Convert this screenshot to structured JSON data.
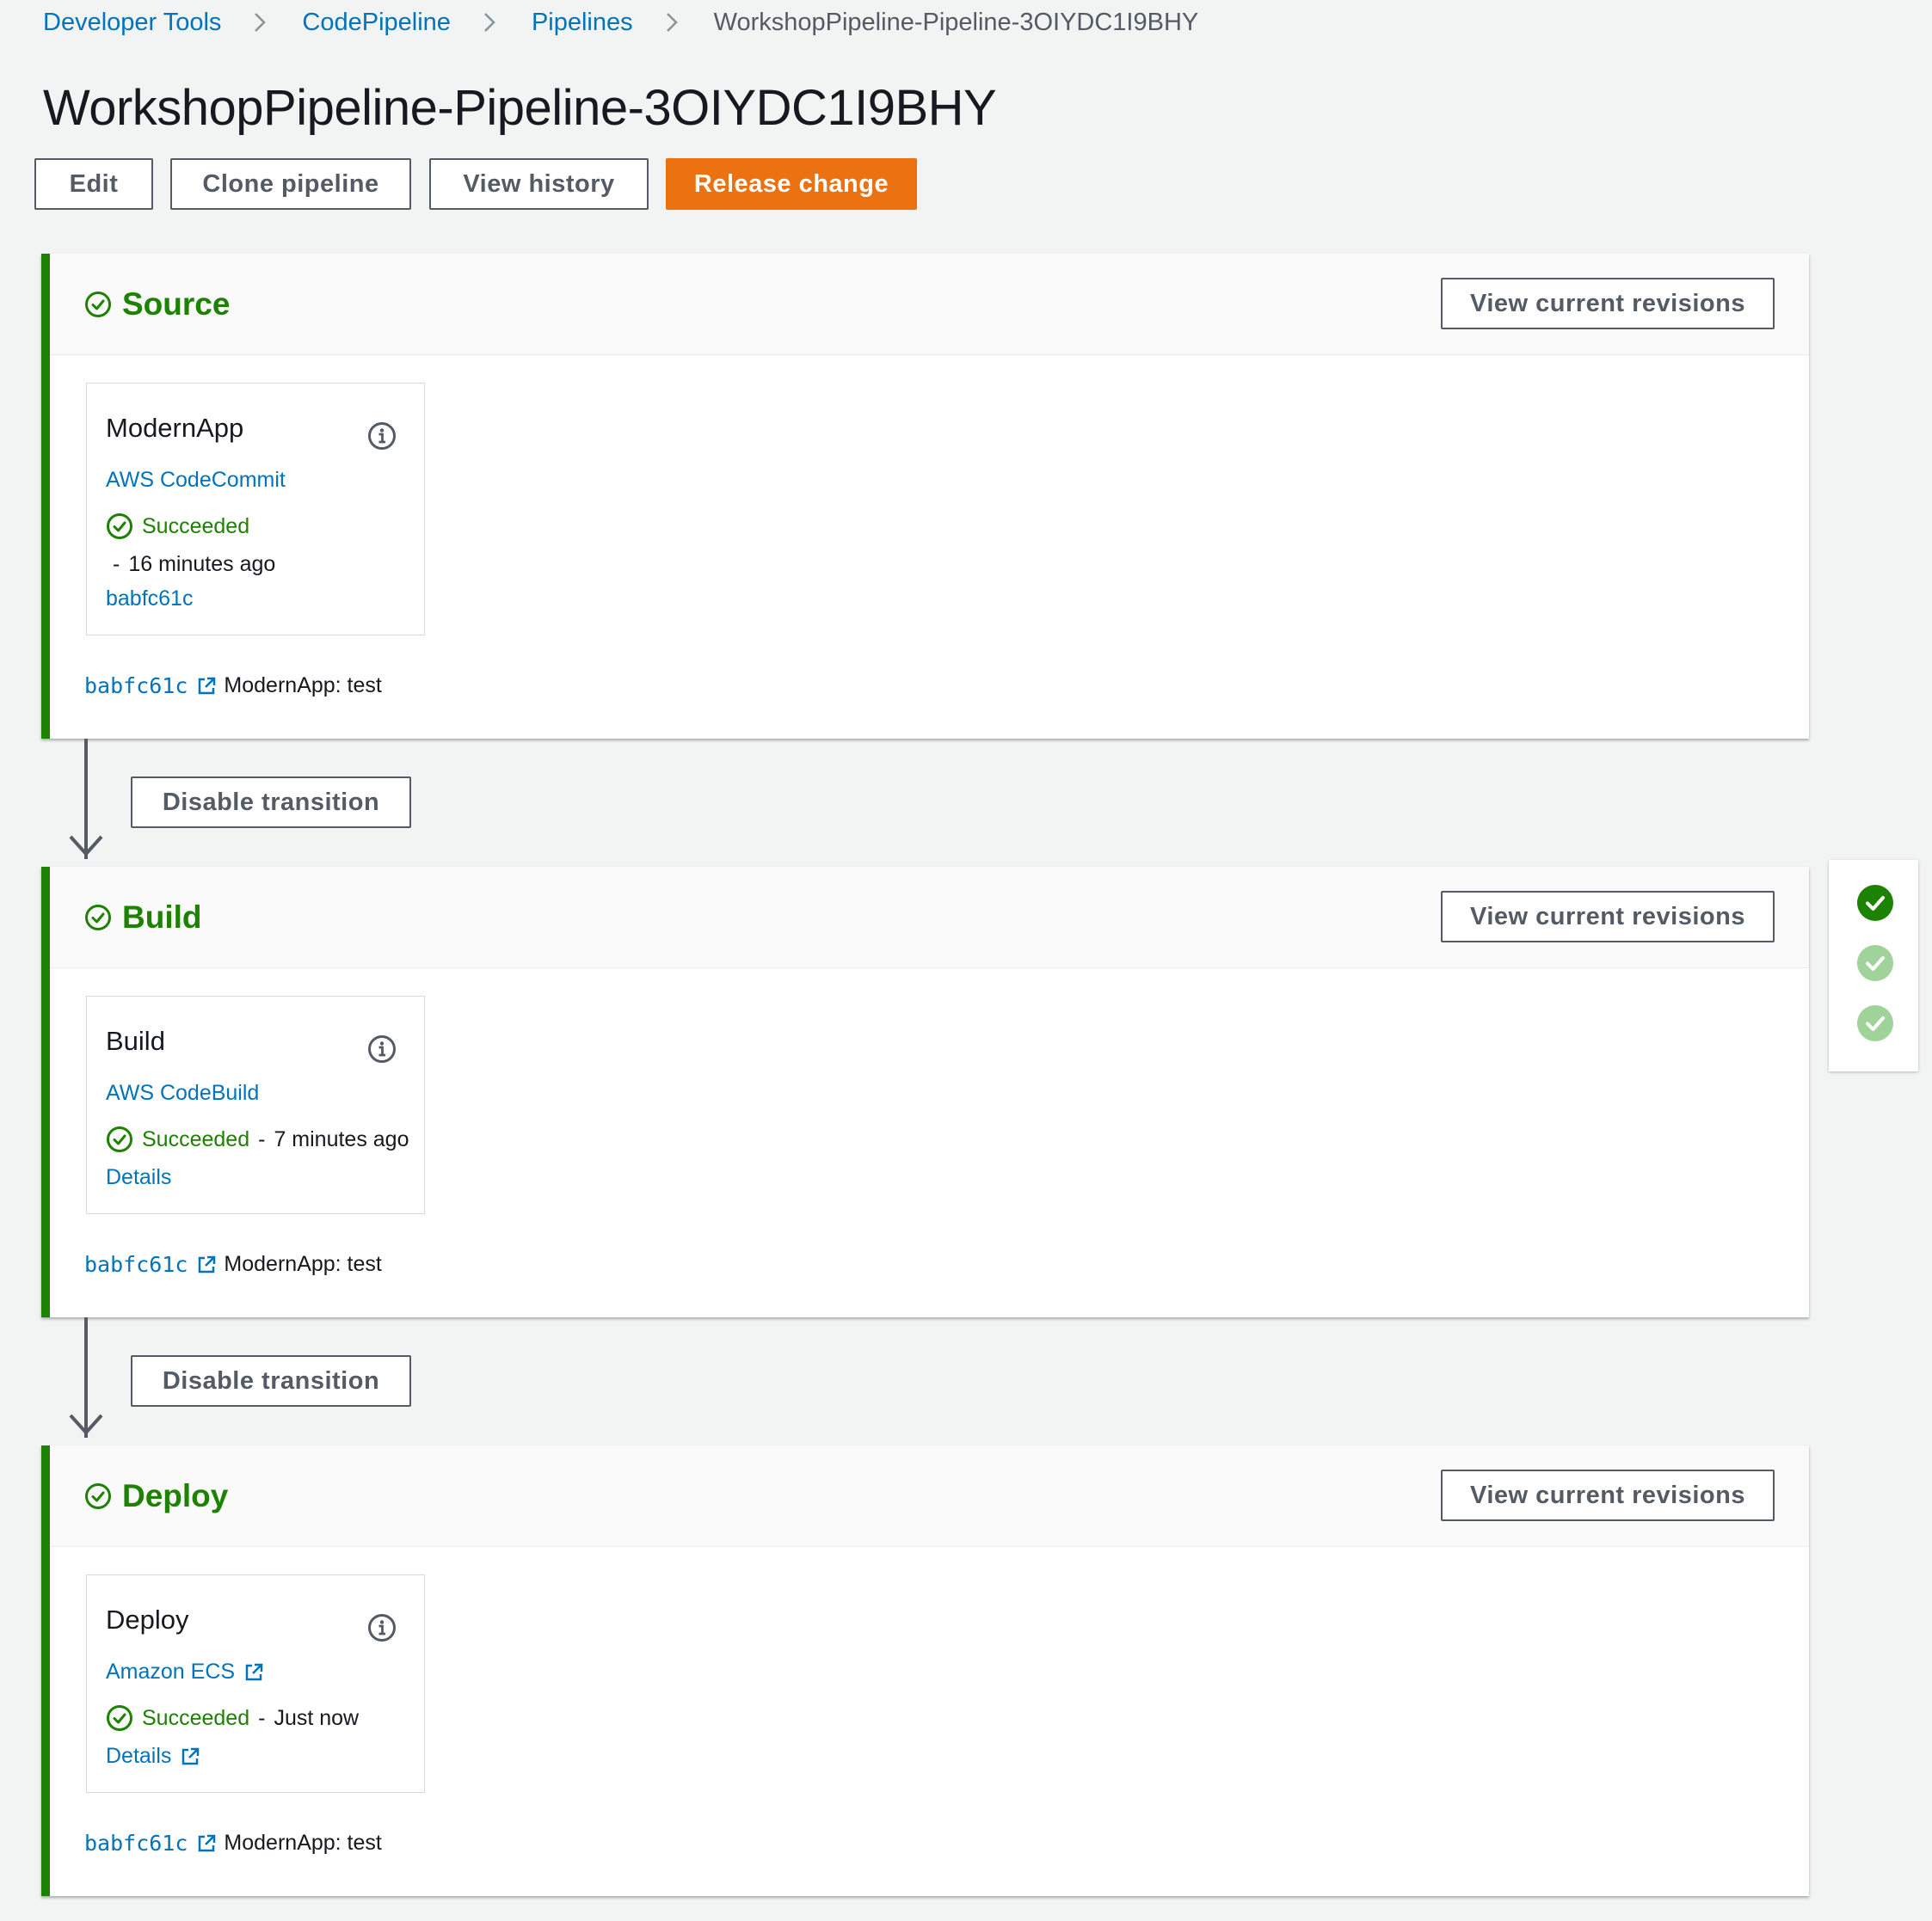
{
  "breadcrumb": {
    "items": [
      "Developer Tools",
      "CodePipeline",
      "Pipelines"
    ],
    "current": "WorkshopPipeline-Pipeline-3OIYDC1I9BHY"
  },
  "page": {
    "title": "WorkshopPipeline-Pipeline-3OIYDC1I9BHY"
  },
  "toolbar": {
    "edit_label": "Edit",
    "clone_label": "Clone pipeline",
    "history_label": "View history",
    "release_label": "Release change"
  },
  "stages": [
    {
      "name": "Source",
      "revisions_label": "View current revisions",
      "action": {
        "name": "ModernApp",
        "provider": "AWS CodeCommit",
        "status": "Succeeded",
        "dash": "-",
        "time": "16 minutes ago",
        "link": "babfc61c"
      },
      "revision": {
        "id": "babfc61c",
        "message": "ModernApp: test"
      }
    },
    {
      "name": "Build",
      "revisions_label": "View current revisions",
      "action": {
        "name": "Build",
        "provider": "AWS CodeBuild",
        "status": "Succeeded",
        "dash": "-",
        "time": "7 minutes ago",
        "link": "Details"
      },
      "revision": {
        "id": "babfc61c",
        "message": "ModernApp: test"
      }
    },
    {
      "name": "Deploy",
      "revisions_label": "View current revisions",
      "action": {
        "name": "Deploy",
        "provider": "Amazon ECS",
        "status": "Succeeded",
        "dash": "-",
        "time": "Just now",
        "link": "Details"
      },
      "revision": {
        "id": "babfc61c",
        "message": "ModernApp: test"
      }
    }
  ],
  "transitions": [
    {
      "label": "Disable transition"
    },
    {
      "label": "Disable transition"
    }
  ],
  "icons": {
    "breadcrumb_separator": "chevron-right-icon",
    "stage_status": "check-circle-icon",
    "info": "info-icon",
    "external": "external-link-icon",
    "arrow": "arrow-down-icon"
  },
  "colors": {
    "success": "#1d8102",
    "link": "#0073bb",
    "primary": "#ec7211",
    "success_light": "#9fd39a"
  }
}
